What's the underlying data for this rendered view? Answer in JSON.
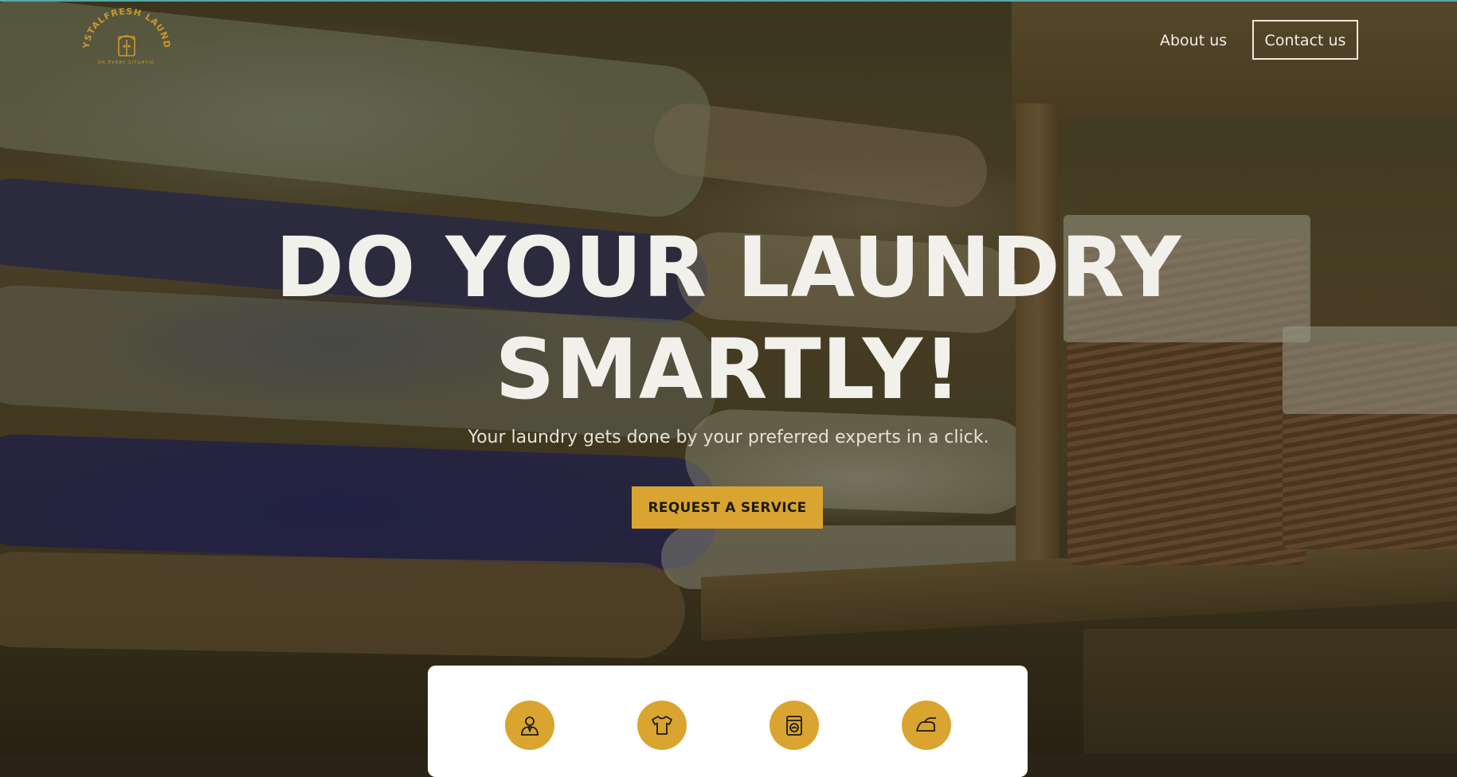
{
  "brand": {
    "name": "CRYSTALFRESH LAUNDRY",
    "tagline": "FOR EVERY SITUATION",
    "logo_color": "#d9a530"
  },
  "nav": {
    "about_label": "About us",
    "contact_label": "Contact us"
  },
  "hero": {
    "title_line1": "DO YOUR LAUNDRY",
    "title_line2": "SMARTLY!",
    "subtitle": "Your laundry gets done by your preferred experts in a click.",
    "cta_label": "REQUEST A SERVICE",
    "accent_color": "#d9a530"
  },
  "features": {
    "icons": [
      {
        "icon": "person-icon"
      },
      {
        "icon": "tshirt-icon"
      },
      {
        "icon": "washing-machine-icon"
      },
      {
        "icon": "iron-icon"
      }
    ]
  }
}
